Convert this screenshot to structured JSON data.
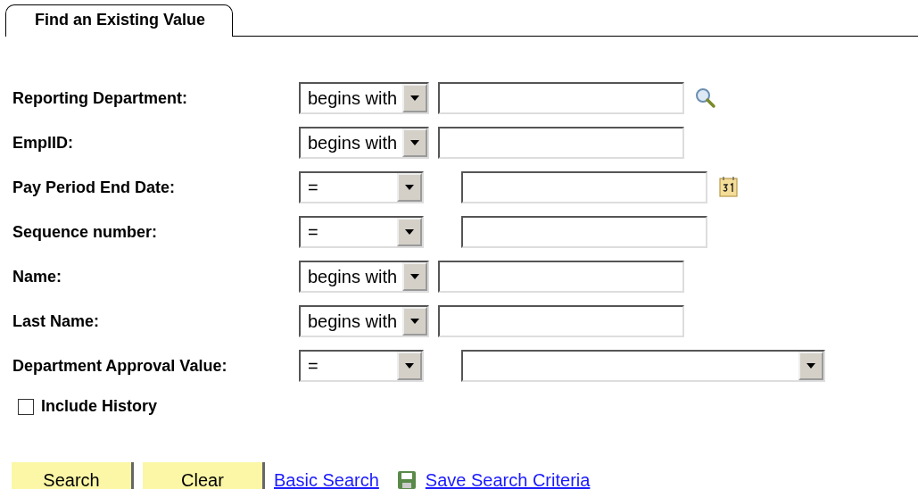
{
  "tab": {
    "label": "Find an Existing Value"
  },
  "fields": [
    {
      "label": "Reporting Department:",
      "operator": "begins with",
      "kind": "lookup"
    },
    {
      "label": "EmplID:",
      "operator": "begins with",
      "kind": "text"
    },
    {
      "label": "Pay Period End Date:",
      "operator": "=",
      "kind": "date"
    },
    {
      "label": "Sequence number:",
      "operator": "=",
      "kind": "text"
    },
    {
      "label": "Name:",
      "operator": "begins with",
      "kind": "text"
    },
    {
      "label": "Last Name:",
      "operator": "begins with",
      "kind": "text"
    },
    {
      "label": "Department Approval Value:",
      "operator": "=",
      "kind": "dropdown"
    }
  ],
  "include_history": {
    "label": "Include History",
    "checked": false
  },
  "buttons": [
    "Search",
    "Clear"
  ],
  "links": [
    {
      "label": "Basic Search",
      "kind": "plain"
    },
    {
      "label": "Save Search Criteria",
      "kind": "save"
    }
  ]
}
